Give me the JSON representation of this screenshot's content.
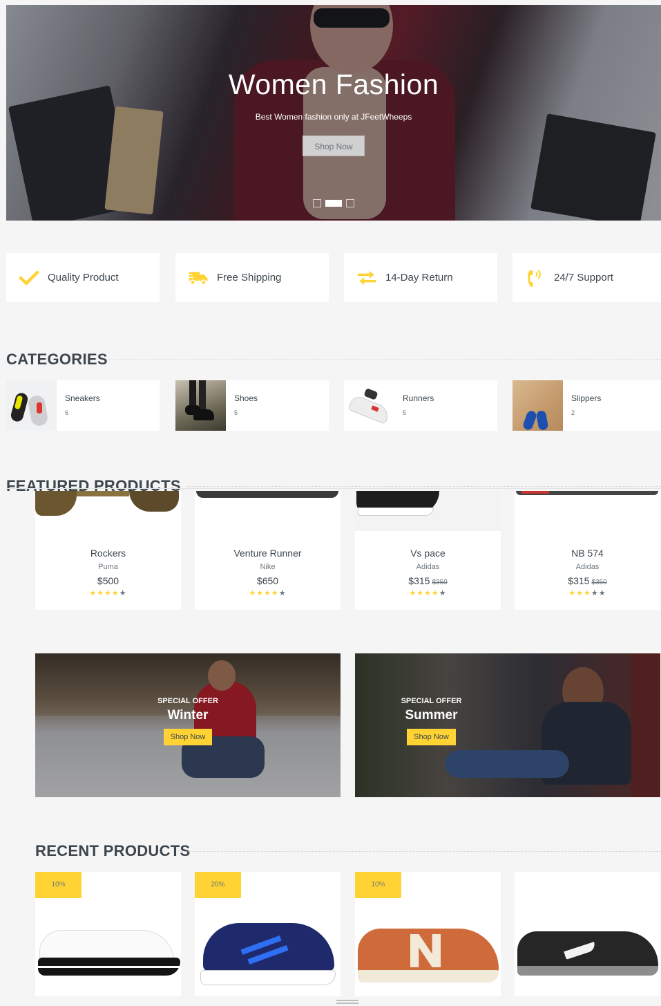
{
  "hero": {
    "title": "Women Fashion",
    "subtitle": "Best Women fashion only at JFeetWheeps",
    "button": "Shop Now",
    "slides": 3,
    "active_slide": 2
  },
  "features": [
    {
      "label": "Quality Product",
      "icon": "check-icon"
    },
    {
      "label": "Free Shipping",
      "icon": "truck-icon"
    },
    {
      "label": "14-Day Return",
      "icon": "exchange-icon"
    },
    {
      "label": "24/7 Support",
      "icon": "phone-volume-icon"
    }
  ],
  "categories": {
    "title": "CATEGORIES",
    "items": [
      {
        "name": "Sneakers",
        "count": "6"
      },
      {
        "name": "Shoes",
        "count": "5"
      },
      {
        "name": "Runners",
        "count": "5"
      },
      {
        "name": "Slippers",
        "count": "2"
      }
    ]
  },
  "featured": {
    "title": "FEATURED PRODUCTS",
    "items": [
      {
        "name": "Rockers",
        "brand": "Puma",
        "price": "$500",
        "old_price": "",
        "rating": 4
      },
      {
        "name": "Venture Runner",
        "brand": "Nike",
        "price": "$650",
        "old_price": "",
        "rating": 4
      },
      {
        "name": "Vs pace",
        "brand": "Adidas",
        "price": "$315",
        "old_price": "$350",
        "rating": 4
      },
      {
        "name": "NB 574",
        "brand": "Adidas",
        "price": "$315",
        "old_price": "$350",
        "rating": 3
      }
    ]
  },
  "offers": [
    {
      "label": "SPECIAL OFFER",
      "name": "Winter",
      "button": "Shop Now"
    },
    {
      "label": "SPECIAL OFFER",
      "name": "Summer",
      "button": "Shop Now"
    }
  ],
  "recent": {
    "title": "RECENT PRODUCTS",
    "items": [
      {
        "badge": "10%"
      },
      {
        "badge": "20%"
      },
      {
        "badge": "10%"
      },
      {
        "badge": ""
      }
    ]
  },
  "colors": {
    "accent": "#ffd333",
    "text": "#3d464d",
    "muted": "#6c757d",
    "background": "#f5f5f5"
  }
}
